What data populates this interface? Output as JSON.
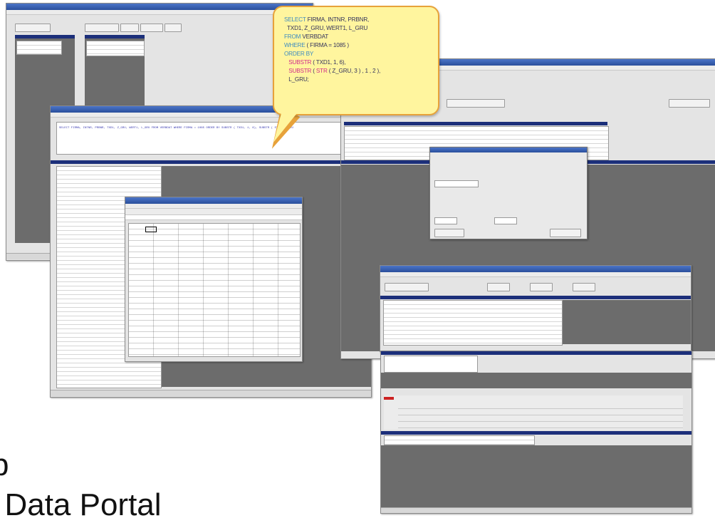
{
  "callout": {
    "sql_lines": [
      {
        "parts": [
          {
            "t": "SELECT",
            "c": "kw"
          },
          {
            "t": " FIRMA, INTNR, PRBNR,",
            "c": ""
          }
        ]
      },
      {
        "parts": [
          {
            "t": "  TXD1, Z_GRU, WERT1, L_GRU",
            "c": ""
          }
        ]
      },
      {
        "parts": [
          {
            "t": "FROM",
            "c": "kw"
          },
          {
            "t": " VERBDAT",
            "c": ""
          }
        ]
      },
      {
        "parts": [
          {
            "t": "WHERE",
            "c": "kw"
          },
          {
            "t": " ( FIRMA = 1085 )",
            "c": ""
          }
        ]
      },
      {
        "parts": [
          {
            "t": "ORDER BY",
            "c": "kw"
          }
        ]
      },
      {
        "parts": [
          {
            "t": "   SUBSTR",
            "c": "fn"
          },
          {
            "t": " ( TXD1, 1, 6),",
            "c": ""
          }
        ]
      },
      {
        "parts": [
          {
            "t": "   SUBSTR",
            "c": "fn"
          },
          {
            "t": " ( ",
            "c": ""
          },
          {
            "t": "STR",
            "c": "fn"
          },
          {
            "t": " ( Z_GRU, 3 ) , 1 , 2 ),",
            "c": ""
          }
        ]
      },
      {
        "parts": [
          {
            "t": "   L_GRU;",
            "c": ""
          }
        ]
      }
    ]
  },
  "background_text": {
    "line1": "p",
    "line2": "t Data Portal"
  },
  "colors": {
    "bubble_fill": "#fff59e",
    "bubble_border": "#e7a23a",
    "keyword": "#3d8cc0",
    "function": "#d12a8a",
    "titlebar": "#2a4f9c",
    "workspace_gray": "#6c6c6c"
  }
}
